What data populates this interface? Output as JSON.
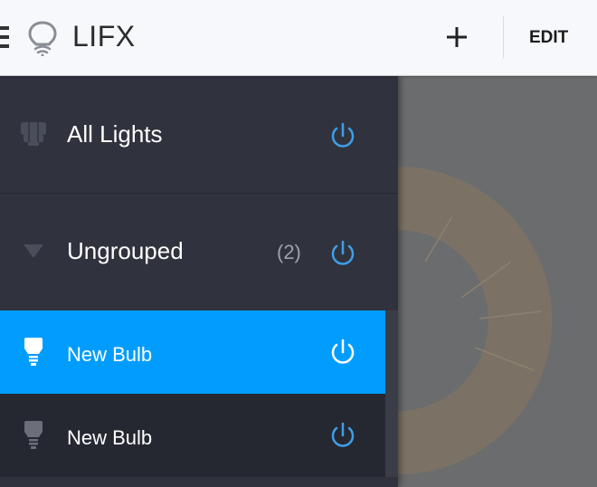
{
  "app": {
    "title": "LIFX"
  },
  "toolbar": {
    "add_icon": "plus-icon",
    "edit_label": "EDIT"
  },
  "drawer": {
    "all_lights": {
      "label": "All Lights",
      "icon": "lights-cluster-icon"
    },
    "group": {
      "label": "Ungrouped",
      "count": "(2)",
      "icon": "triangle-down-icon"
    },
    "bulbs": [
      {
        "label": "New Bulb",
        "selected": true
      },
      {
        "label": "New Bulb",
        "selected": false
      }
    ]
  },
  "colors": {
    "accent": "#009dff",
    "power_icon": "#3f9ee6",
    "drawer_bg": "#30333e",
    "topbar_bg": "#f6f8fc"
  }
}
